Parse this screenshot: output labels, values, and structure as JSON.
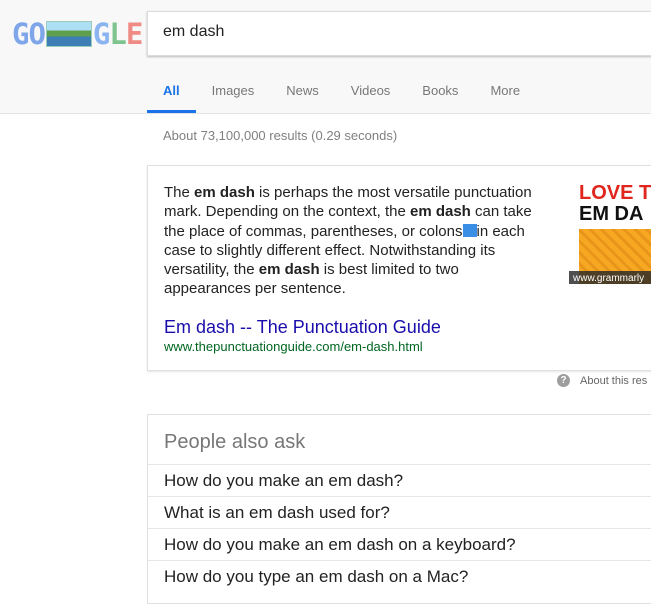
{
  "logo": {
    "letters_left": "GO",
    "letters_right": "GLE"
  },
  "search": {
    "query": "em dash"
  },
  "tabs": [
    {
      "label": "All",
      "active": true
    },
    {
      "label": "Images"
    },
    {
      "label": "News"
    },
    {
      "label": "Videos"
    },
    {
      "label": "Books"
    },
    {
      "label": "More"
    }
  ],
  "result_stats": "About 73,100,000 results (0.29 seconds)",
  "featured_snippet": {
    "segments": [
      "The ",
      "em dash",
      " is perhaps the most versatile punctuation mark. Depending on the context, the ",
      "em dash",
      " can take the place of commas, parentheses, or colons",
      "in each case to slightly different effect. Notwithstanding its versatility, the ",
      "em dash",
      " is best limited to two appearances per sentence."
    ],
    "source_title_a": "Em dash",
    "source_title_sep": " -- ",
    "source_title_b": "The Punctuation Guide",
    "source_url": "www.thepunctuationguide.com/em-dash.html",
    "image": {
      "line1": "LOVE T",
      "line2": "EM DA",
      "caption": "www.grammarly"
    }
  },
  "about_link": "About this res",
  "people_also_ask": {
    "title": "People also ask",
    "questions": [
      "How do you make an em dash?",
      "What is an em dash used for?",
      "How do you make an em dash on a keyboard?",
      "How do you type an em dash on a Mac?"
    ]
  },
  "colors": {
    "accent": "#1a73e8",
    "link": "#1a0dab",
    "url": "#006621"
  }
}
